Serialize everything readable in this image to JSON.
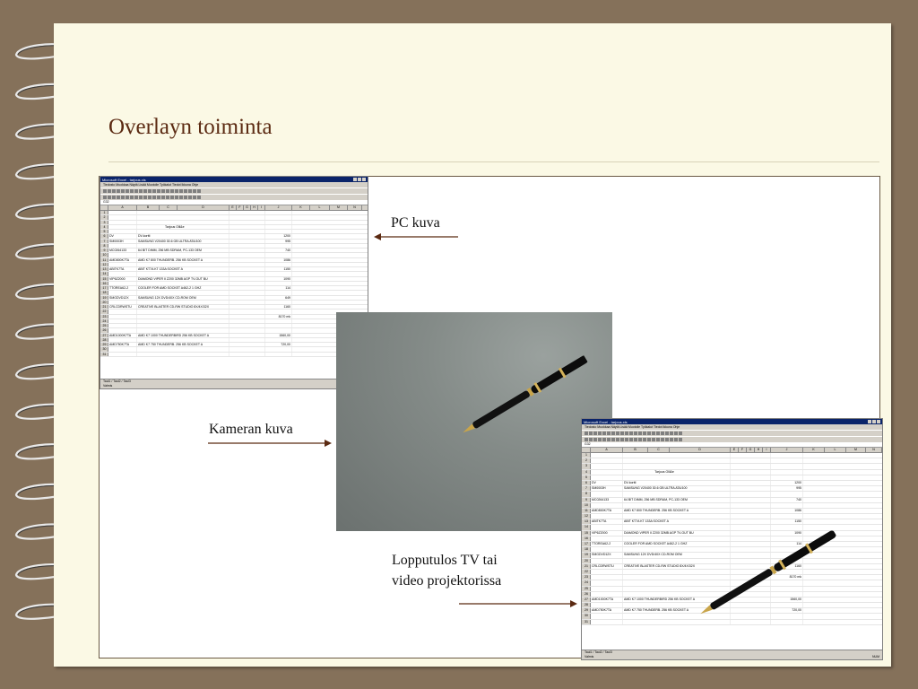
{
  "slide": {
    "title": "Overlayn toiminta"
  },
  "labels": {
    "pc": "PC kuva",
    "camera": "Kameran kuva",
    "result_line1": "Lopputulos TV tai",
    "result_line2": "video projektorissa"
  },
  "excel": {
    "title": "Microsoft Excel - tarjous.xls",
    "menu": "Tiedosto  Muokkaa  Näytä  Lisää  Muotoile  Työkalut  Tiedot  Ikkuna  Ohje",
    "name_box": "G32",
    "columns": [
      "A",
      "B",
      "C",
      "D",
      "E",
      "F",
      "G",
      "H",
      "I",
      "J",
      "K",
      "L",
      "M",
      "N"
    ],
    "header_row": {
      "n": "4",
      "text": "Tarjous Olli&e"
    },
    "rows": [
      {
        "n": "6",
        "code": "DV",
        "desc": "DV-kortti",
        "price": "1200"
      },
      {
        "n": "7",
        "code": "SM0003H",
        "desc": "SAMSUNG V20400 30.6 GB ULTRA ATA/100",
        "price": "995"
      },
      {
        "n": "9",
        "code": "MC0264133",
        "desc": "64 BIT DIMM, 256 MB SDRAM, PC-133 OEM",
        "price": "740"
      },
      {
        "n": "11",
        "code": "AMD800K7TA",
        "desc": "AMD K7 800 THUNDERB. 256 KB SOCKET A",
        "price": "1086"
      },
      {
        "n": "13",
        "code": "ABITK7TA",
        "desc": "ABIT KT7A KT 133A SOCKET A",
        "price": "1150"
      },
      {
        "n": "15",
        "code": "VIP6Z2000",
        "desc": "DIAMOND VIPER II Z200 32MB AGP TV-OUT BU",
        "price": "1090"
      },
      {
        "n": "17",
        "code": "TTOREA62-2",
        "desc": "COOLER FOR AMD SOCKET A462-2 1 GHZ",
        "price": "114"
      },
      {
        "n": "19",
        "code": "SMGDVD12X",
        "desc": "SAMSUNG 12X DVD/40X CD-ROM OEM",
        "price": "649"
      },
      {
        "n": "21",
        "code": "CRLCDRWSTU",
        "desc": "CREATIVE BLASTER CD-RW STUDIO 8X/4X/32X",
        "price": "1160"
      },
      {
        "n": "23",
        "code": "",
        "desc": "",
        "price": "8170 mk"
      },
      {
        "n": "27",
        "code": "AMD1000K7TA",
        "desc": "AMD K7 1000 THUNDERBIRD 256 KB SOCKET A",
        "price": "1560,00"
      },
      {
        "n": "29",
        "code": "AMD750K7TA",
        "desc": "AMD K7 750 THUNDERB. 256 KB SOCKET A",
        "price": "720,00"
      }
    ],
    "tabs": "Taul1 / Taul2 / Taul3",
    "status_left": "Valmis",
    "status_right": "NUM"
  },
  "colors": {
    "background": "#85715a",
    "slide": "#fbf9e5",
    "title": "#5b2a12",
    "arrow": "#5b2a12"
  }
}
